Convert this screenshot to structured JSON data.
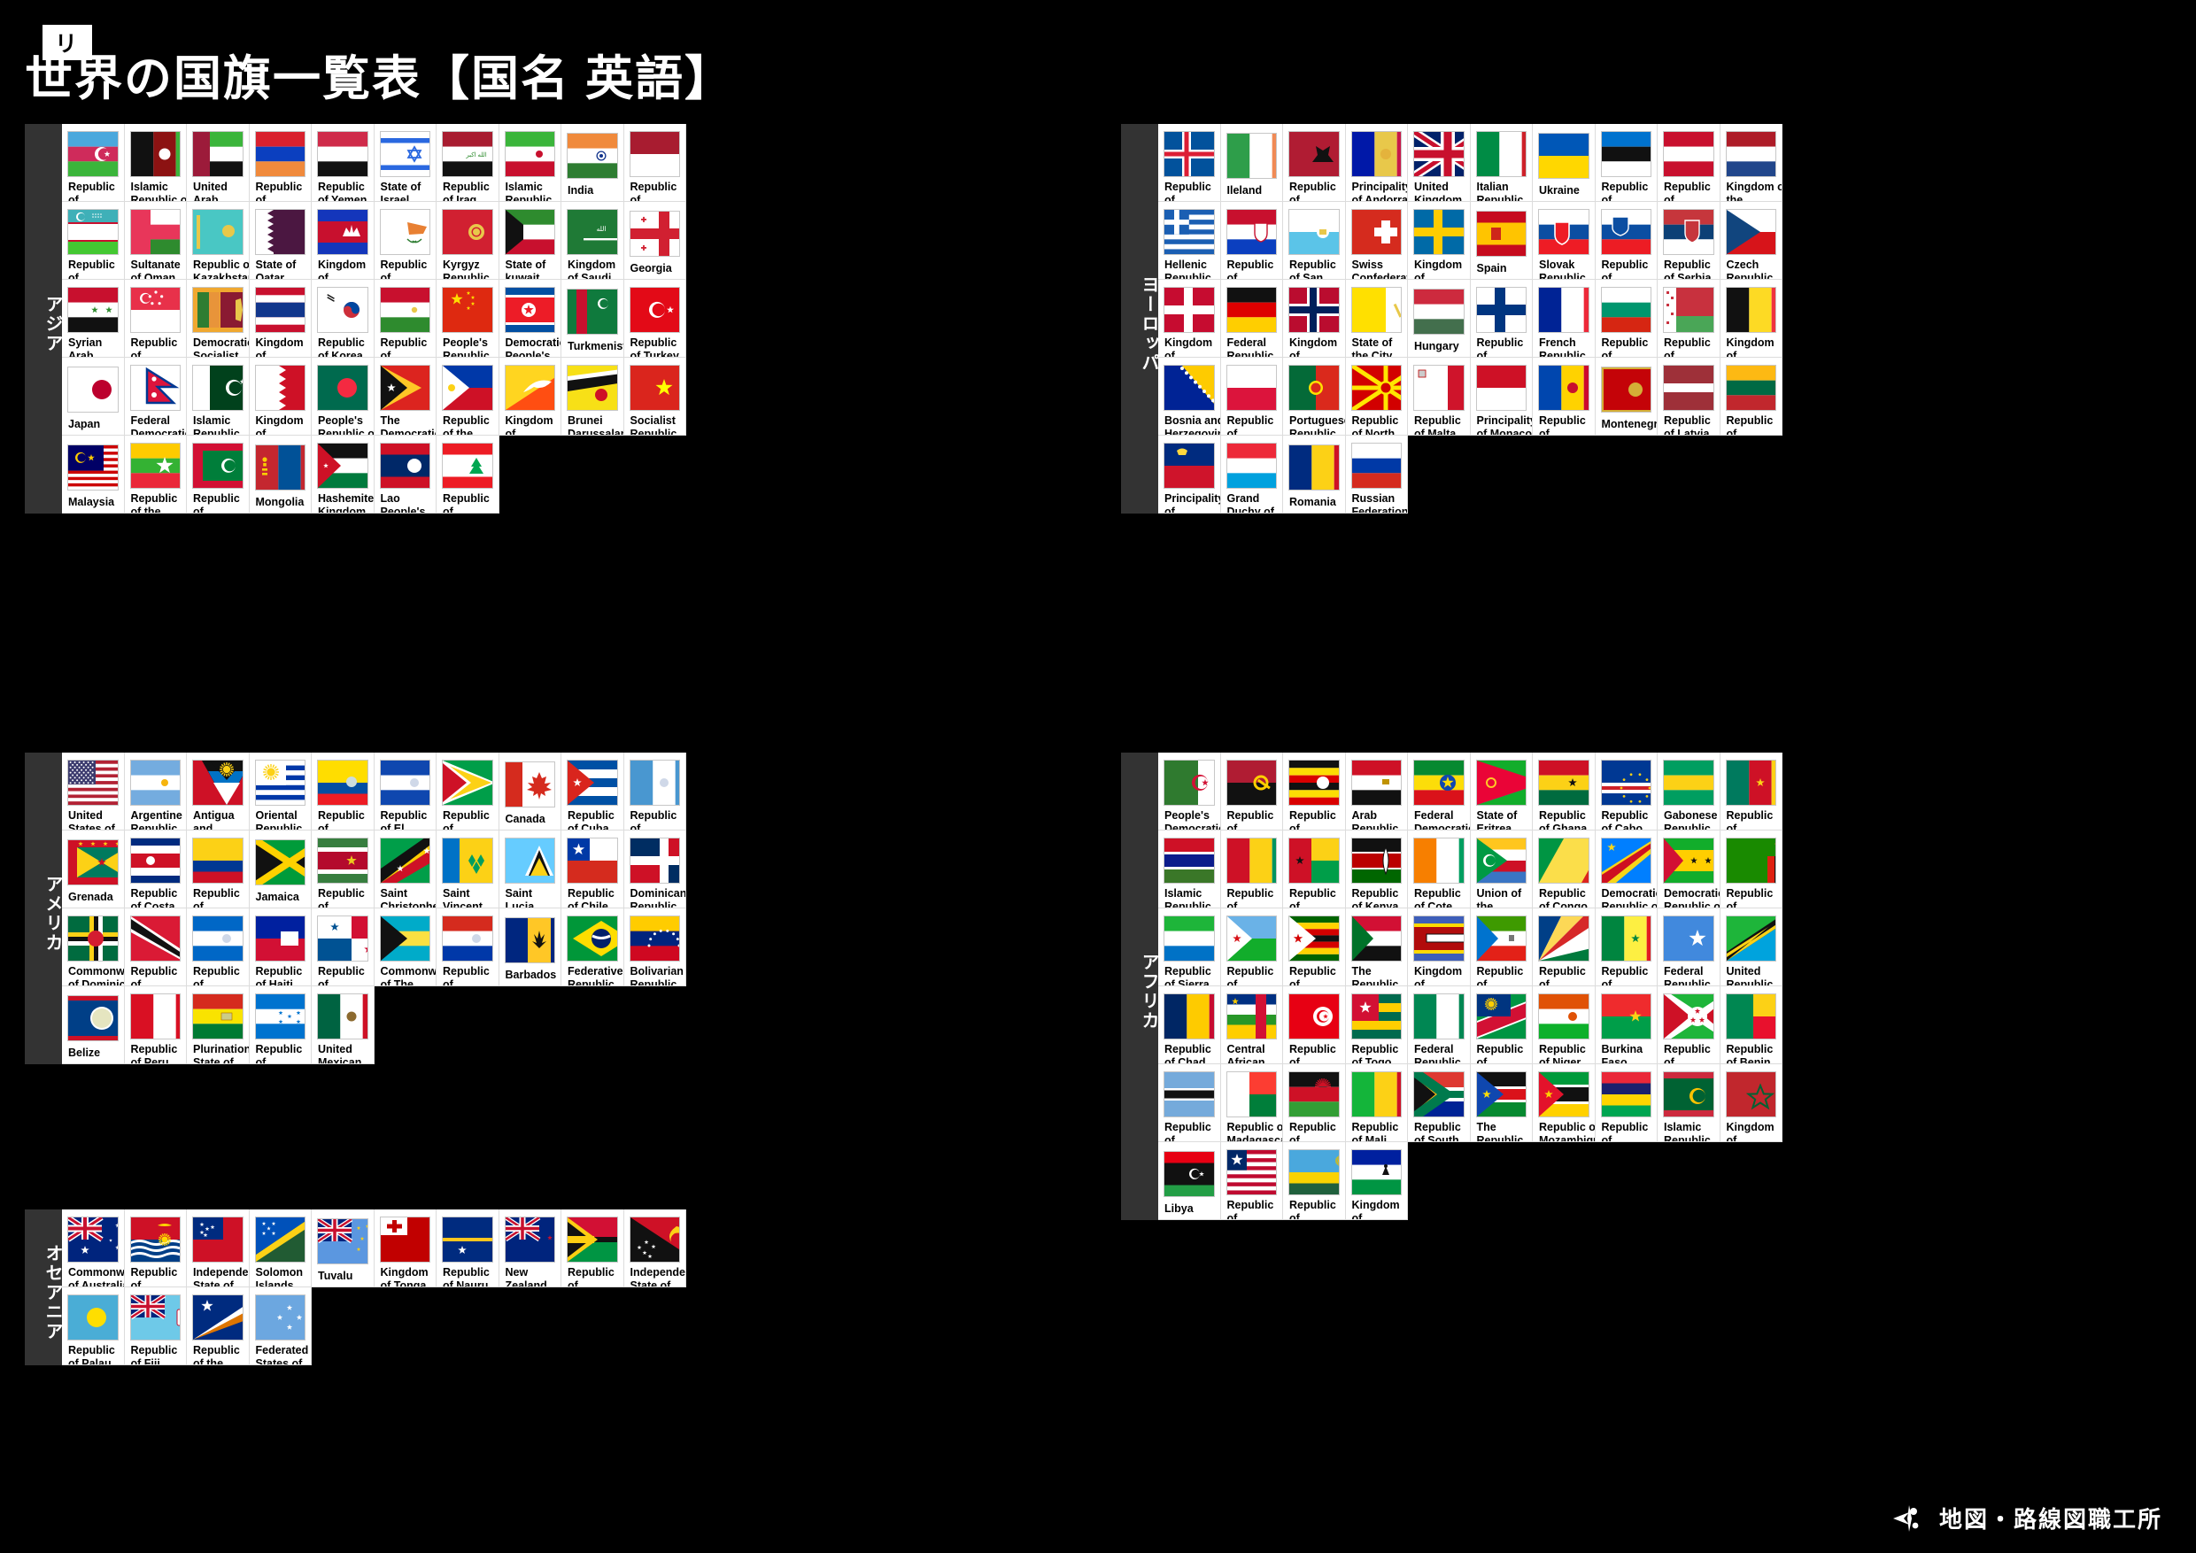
{
  "header": {
    "series_tag": "世界の国旗プリントシリーズ",
    "title": "世界の国旗一覧表【国名 英語】"
  },
  "footer": {
    "logo_text": "地図・路線図職工所",
    "mark_icon": "compass-mark-icon"
  },
  "colors": {
    "background": "#000000",
    "card": "#ffffff",
    "grid_line": "#dcdcdc",
    "region_label_bg": "#333333",
    "region_label_text": "#ffffff"
  },
  "regions": [
    {
      "id": "asia",
      "label": "アジア",
      "columns": 10,
      "countries": [
        {
          "name": "Republic of Azerbaijan",
          "flag": "az"
        },
        {
          "name": "Islamic Republic of Afghanistan",
          "flag": "af"
        },
        {
          "name": "United Arab Emirates",
          "flag": "ae"
        },
        {
          "name": "Republic of Armania",
          "flag": "am"
        },
        {
          "name": "Republic of Yemen",
          "flag": "ye"
        },
        {
          "name": "State of Israel",
          "flag": "il"
        },
        {
          "name": "Republic of Iraq",
          "flag": "iq"
        },
        {
          "name": "Islamic Republic of Iran",
          "flag": "ir"
        },
        {
          "name": "India",
          "flag": "in"
        },
        {
          "name": "Republic of Indnesia",
          "flag": "id"
        },
        {
          "name": "Republic of Uzbekistan",
          "flag": "uz"
        },
        {
          "name": "Sultanate of Oman",
          "flag": "om"
        },
        {
          "name": "Republic of Kazakhstan",
          "flag": "kz"
        },
        {
          "name": "State of Qatar",
          "flag": "qa"
        },
        {
          "name": "Kingdom of Cambodia",
          "flag": "kh"
        },
        {
          "name": "Republic of Cyprus",
          "flag": "cy"
        },
        {
          "name": "Kyrgyz Republic",
          "flag": "kg"
        },
        {
          "name": "State of kuwait",
          "flag": "kw"
        },
        {
          "name": "Kingdom of Saudi Arabia",
          "flag": "sa"
        },
        {
          "name": "Georgia",
          "flag": "ge"
        },
        {
          "name": "Syrian Arab Republic",
          "flag": "sy"
        },
        {
          "name": "Republic of Singapore",
          "flag": "sg"
        },
        {
          "name": "Democratic Socialist Republic of Sri Lanka",
          "flag": "lk"
        },
        {
          "name": "Kingdom of Thailand",
          "flag": "th"
        },
        {
          "name": "Republic of Korea",
          "flag": "kr"
        },
        {
          "name": "Republic of Tajikistan",
          "flag": "tj"
        },
        {
          "name": "People's Republic of China",
          "flag": "cn"
        },
        {
          "name": "Democratic People's Republic of Korea",
          "flag": "kp"
        },
        {
          "name": "Turkmenistan",
          "flag": "tm"
        },
        {
          "name": "Republic of Turkey",
          "flag": "tr"
        },
        {
          "name": "Japan",
          "flag": "jp"
        },
        {
          "name": "Federal Democratic Republic of Nepal",
          "flag": "np"
        },
        {
          "name": "Islamic Republic of Pakistan",
          "flag": "pk"
        },
        {
          "name": "Kingdom of Bahrain",
          "flag": "bh"
        },
        {
          "name": "People's Republic of Bangladesh",
          "flag": "bd"
        },
        {
          "name": "The Democratic Republic of Timor-Leste",
          "flag": "tl"
        },
        {
          "name": "Republic of the Philippines",
          "flag": "ph"
        },
        {
          "name": "Kingdom of Bhutan",
          "flag": "bt"
        },
        {
          "name": "Brunei Darussalam",
          "flag": "bn"
        },
        {
          "name": "Socialist Republic of Viet Nam",
          "flag": "vn"
        },
        {
          "name": "Malaysia",
          "flag": "my"
        },
        {
          "name": "Republic of the Union of Myanmar",
          "flag": "mm"
        },
        {
          "name": "Republic of Maldives",
          "flag": "mv"
        },
        {
          "name": "Mongolia",
          "flag": "mn"
        },
        {
          "name": "Hashemite Kingdom of Jordan",
          "flag": "jo"
        },
        {
          "name": "Lao People's Democratic Republic",
          "flag": "la"
        },
        {
          "name": "Republic of Lebanon",
          "flag": "lb"
        }
      ]
    },
    {
      "id": "europe",
      "label": "ヨーロッパ",
      "columns": 10,
      "countries": [
        {
          "name": "Republic of Iceland",
          "flag": "is"
        },
        {
          "name": "Ileland",
          "flag": "ie"
        },
        {
          "name": "Republic of Albania",
          "flag": "al"
        },
        {
          "name": "Principality of Andorra",
          "flag": "ad"
        },
        {
          "name": "United Kingdom Great Britain and Northern Ireland",
          "flag": "gb"
        },
        {
          "name": "Italian Republic",
          "flag": "it"
        },
        {
          "name": "Ukraine",
          "flag": "ua"
        },
        {
          "name": "Republic of Estonia",
          "flag": "ee"
        },
        {
          "name": "Republic of Austria",
          "flag": "at"
        },
        {
          "name": "Kingdom of the Netherlands",
          "flag": "nl"
        },
        {
          "name": "Hellenic Republic",
          "flag": "gr"
        },
        {
          "name": "Republic of Croatia",
          "flag": "hr"
        },
        {
          "name": "Republic of San Marino",
          "flag": "sm"
        },
        {
          "name": "Swiss Confederation",
          "flag": "ch"
        },
        {
          "name": "Kingdom of Sweden",
          "flag": "se"
        },
        {
          "name": "Spain",
          "flag": "es"
        },
        {
          "name": "Slovak Republic",
          "flag": "sk"
        },
        {
          "name": "Republic of Slovenia",
          "flag": "si"
        },
        {
          "name": "Republic of Serbia",
          "flag": "rs"
        },
        {
          "name": "Czech Republic",
          "flag": "cz"
        },
        {
          "name": "Kingdom of Denmark",
          "flag": "dk"
        },
        {
          "name": "Federal Republic of Germany",
          "flag": "de"
        },
        {
          "name": "Kingdom of Norway",
          "flag": "no"
        },
        {
          "name": "State of the City of Vatican",
          "flag": "va"
        },
        {
          "name": "Hungary",
          "flag": "hu"
        },
        {
          "name": "Republic of Finland",
          "flag": "fi"
        },
        {
          "name": "French Republic",
          "flag": "fr"
        },
        {
          "name": "Republic of Bulgaria",
          "flag": "bg"
        },
        {
          "name": "Republic of Belarus",
          "flag": "by"
        },
        {
          "name": "Kingdom of Belgium",
          "flag": "be"
        },
        {
          "name": "Bosnia and Herzegovina",
          "flag": "ba"
        },
        {
          "name": "Republic of Poland",
          "flag": "pl"
        },
        {
          "name": "Portuguese Republic",
          "flag": "pt"
        },
        {
          "name": "Republic of North Macedonia",
          "flag": "mk"
        },
        {
          "name": "Republic of Malta",
          "flag": "mt"
        },
        {
          "name": "Principality of Monaco",
          "flag": "mc"
        },
        {
          "name": "Republic of Moldova",
          "flag": "md"
        },
        {
          "name": "Montenegro",
          "flag": "me"
        },
        {
          "name": "Republic of Latvia",
          "flag": "lv"
        },
        {
          "name": "Republic of Lithuania",
          "flag": "lt"
        },
        {
          "name": "Principality of Liechtenstein",
          "flag": "li"
        },
        {
          "name": "Grand Duchy of Luxembourg",
          "flag": "lu"
        },
        {
          "name": "Romania",
          "flag": "ro"
        },
        {
          "name": "Russian Federation",
          "flag": "ru"
        }
      ]
    },
    {
      "id": "america",
      "label": "アメリカ",
      "columns": 10,
      "countries": [
        {
          "name": "United States of America",
          "flag": "us"
        },
        {
          "name": "Argentine Republic",
          "flag": "ar"
        },
        {
          "name": "Antigua and Barbuda",
          "flag": "ag"
        },
        {
          "name": "Oriental Republic of Uruguay",
          "flag": "uy"
        },
        {
          "name": "Republic of Ecuador",
          "flag": "ec"
        },
        {
          "name": "Republic of El Salvador",
          "flag": "sv"
        },
        {
          "name": "Republic of Guyana",
          "flag": "gy"
        },
        {
          "name": "Canada",
          "flag": "ca"
        },
        {
          "name": "Republic of Cuba",
          "flag": "cu"
        },
        {
          "name": "Republic of Guatemala",
          "flag": "gt"
        },
        {
          "name": "Grenada",
          "flag": "gd"
        },
        {
          "name": "Republic of Costa Rica",
          "flag": "cr"
        },
        {
          "name": "Republic of Colombia",
          "flag": "co"
        },
        {
          "name": "Jamaica",
          "flag": "jm"
        },
        {
          "name": "Republic of Suriname",
          "flag": "sr"
        },
        {
          "name": "Saint Christopher and Nevis",
          "flag": "kn"
        },
        {
          "name": "Saint Vincent and the Grenadines",
          "flag": "vc"
        },
        {
          "name": "Saint Lucia",
          "flag": "lc"
        },
        {
          "name": "Republic of Chile",
          "flag": "cl"
        },
        {
          "name": "Dominican Republic",
          "flag": "do"
        },
        {
          "name": "Commonwealth of Dominica",
          "flag": "dm"
        },
        {
          "name": "Republic of Trinidad and Tobago",
          "flag": "tt"
        },
        {
          "name": "Republic of Nicaragua",
          "flag": "ni"
        },
        {
          "name": "Republic of Haiti",
          "flag": "ht"
        },
        {
          "name": "Republic of Panama",
          "flag": "pa"
        },
        {
          "name": "Commonwealth of The Bahamas",
          "flag": "bs"
        },
        {
          "name": "Republic of Paraguay",
          "flag": "py"
        },
        {
          "name": "Barbados",
          "flag": "bb"
        },
        {
          "name": "Federative Republic of Brazil",
          "flag": "br"
        },
        {
          "name": "Bolivarian Republic of Venezuela",
          "flag": "ve"
        },
        {
          "name": "Belize",
          "flag": "bz"
        },
        {
          "name": "Republic of Peru",
          "flag": "pe"
        },
        {
          "name": "Plurinational State of Bolivia",
          "flag": "bo"
        },
        {
          "name": "Republic of Honduras",
          "flag": "hn"
        },
        {
          "name": "United Mexican States",
          "flag": "mx"
        }
      ]
    },
    {
      "id": "africa",
      "label": "アフリカ",
      "columns": 10,
      "countries": [
        {
          "name": "People's Democratic Republic of Algeria",
          "flag": "dz"
        },
        {
          "name": "Republic of Angola",
          "flag": "ao"
        },
        {
          "name": "Republic of Uganda",
          "flag": "ug"
        },
        {
          "name": "Arab Republic of Egypt",
          "flag": "eg"
        },
        {
          "name": "Federal Democratic Republic of Ethiopia",
          "flag": "et"
        },
        {
          "name": "State of Eritrea",
          "flag": "er"
        },
        {
          "name": "Republic of Ghana",
          "flag": "gh"
        },
        {
          "name": "Republic of Cabo Verde",
          "flag": "cv"
        },
        {
          "name": "Gabonese Republic",
          "flag": "ga"
        },
        {
          "name": "Republic of Cameroon",
          "flag": "cm"
        },
        {
          "name": "Islamic Republic of the Gambia",
          "flag": "gm"
        },
        {
          "name": "Republic of Guinea",
          "flag": "gn"
        },
        {
          "name": "Republic of Guinea-Bissau",
          "flag": "gw"
        },
        {
          "name": "Republic of Kenya",
          "flag": "ke"
        },
        {
          "name": "Republic of Cote d'Ivoire",
          "flag": "ci"
        },
        {
          "name": "Union of the Comoros",
          "flag": "km"
        },
        {
          "name": "Republic of Congo",
          "flag": "cg"
        },
        {
          "name": "Democratic Republic of the Congo",
          "flag": "cd"
        },
        {
          "name": "Democratic Republic of Sao Tome and Principe",
          "flag": "st"
        },
        {
          "name": "Republic of Zambia",
          "flag": "zm"
        },
        {
          "name": "Republic of Sierra Leone",
          "flag": "sl"
        },
        {
          "name": "Republic of Djibouti",
          "flag": "dj"
        },
        {
          "name": "Republic of Zimbabwe",
          "flag": "zw"
        },
        {
          "name": "The Republic of the Sudan",
          "flag": "sd"
        },
        {
          "name": "Kingdom of Eswatini",
          "flag": "sz"
        },
        {
          "name": "Republic of Equatorial Guinea",
          "flag": "gq"
        },
        {
          "name": "Republic of Seychelles",
          "flag": "sc"
        },
        {
          "name": "Republic of Senegal",
          "flag": "sn"
        },
        {
          "name": "Federal Republic of Somalia",
          "flag": "so"
        },
        {
          "name": "United Republic of Tanzania",
          "flag": "tz"
        },
        {
          "name": "Republic of Chad",
          "flag": "td"
        },
        {
          "name": "Central African Republic",
          "flag": "cf"
        },
        {
          "name": "Republic of Tunisia",
          "flag": "tn"
        },
        {
          "name": "Republic of Togo",
          "flag": "tg"
        },
        {
          "name": "Federal Republic of Nigeria",
          "flag": "ng"
        },
        {
          "name": "Republic of Namibia",
          "flag": "na"
        },
        {
          "name": "Republic of Niger",
          "flag": "ne"
        },
        {
          "name": "Burkina Faso",
          "flag": "bf"
        },
        {
          "name": "Republic of Burundi",
          "flag": "bi"
        },
        {
          "name": "Republic of Benin",
          "flag": "bj"
        },
        {
          "name": "Republic of Botswana",
          "flag": "bw"
        },
        {
          "name": "Republic of Madagascar",
          "flag": "mg"
        },
        {
          "name": "Republic of Malawi",
          "flag": "mw"
        },
        {
          "name": "Republic of Mali",
          "flag": "ml"
        },
        {
          "name": "Republic of South Africa",
          "flag": "za"
        },
        {
          "name": "The Republic of South Sudan",
          "flag": "ss"
        },
        {
          "name": "Republic of Mozambique",
          "flag": "mz"
        },
        {
          "name": "Republic of Mauritius",
          "flag": "mu"
        },
        {
          "name": "Islamic Republic of Mauritania",
          "flag": "mr"
        },
        {
          "name": "Kingdom of Morocco",
          "flag": "ma"
        },
        {
          "name": "Libya",
          "flag": "ly"
        },
        {
          "name": "Republic of Liberia",
          "flag": "lr"
        },
        {
          "name": "Republic of Rwanda",
          "flag": "rw"
        },
        {
          "name": "Kingdom of Lesotho",
          "flag": "ls"
        }
      ]
    },
    {
      "id": "oceania",
      "label": "オセアニア",
      "columns": 10,
      "countries": [
        {
          "name": "Commonwealth of Australia",
          "flag": "au"
        },
        {
          "name": "Republic of Kiribati",
          "flag": "ki"
        },
        {
          "name": "Independent State of Samoa",
          "flag": "ws"
        },
        {
          "name": "Solomon Islands",
          "flag": "sb"
        },
        {
          "name": "Tuvalu",
          "flag": "tv"
        },
        {
          "name": "Kingdom of Tonga",
          "flag": "to"
        },
        {
          "name": "Republic of Nauru",
          "flag": "nr"
        },
        {
          "name": "New Zealand",
          "flag": "nz"
        },
        {
          "name": "Republic of Vanuatu",
          "flag": "vu"
        },
        {
          "name": "Independent State of Papua New Guinea",
          "flag": "pg"
        },
        {
          "name": "Republic of Palau",
          "flag": "pw"
        },
        {
          "name": "Republic of Fiji",
          "flag": "fj"
        },
        {
          "name": "Republic of the Marshall Islands",
          "flag": "mh"
        },
        {
          "name": "Federated States of Micronesia",
          "flag": "fm"
        }
      ]
    }
  ]
}
